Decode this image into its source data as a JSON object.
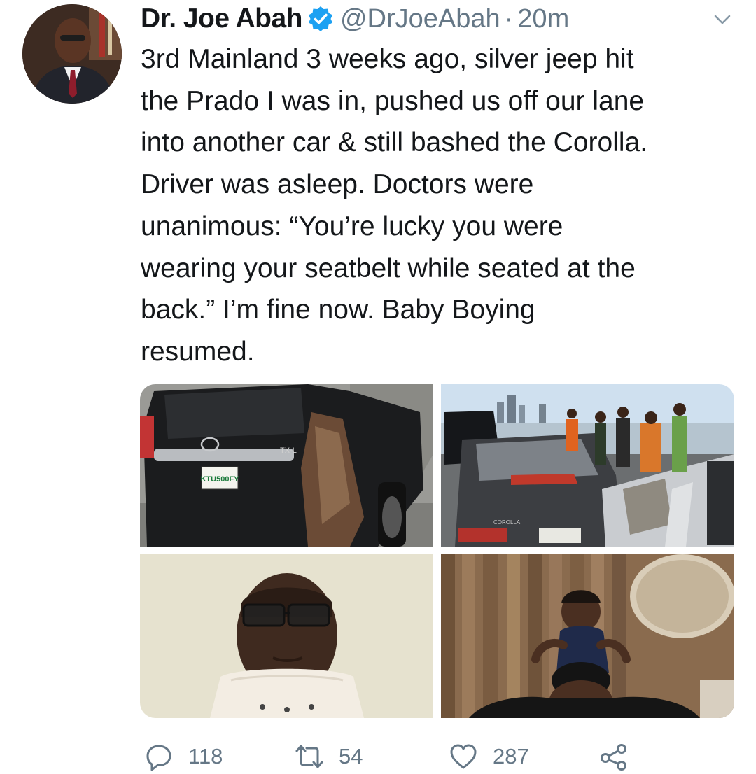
{
  "tweet": {
    "author_name": "Dr. Joe Abah",
    "handle": "@DrJoeAbah",
    "separator": "·",
    "time": "20m",
    "text": "3rd Mainland 3 weeks ago, silver jeep hit\nthe Prado I was in, pushed us off our lane\ninto another car & still bashed the Corolla.\nDriver was asleep. Doctors were\nunanimous: “You’re lucky you were\nwearing your seatbelt while seated at the\nback.” I’m fine now. Baby Boying\nresumed.",
    "media": {
      "photo1": {
        "badge": "TX-L",
        "plate": "KTU500FY"
      },
      "photo2": {
        "model_badge": "COROLLA"
      }
    }
  },
  "actions": {
    "replies": "118",
    "retweets": "54",
    "likes": "287"
  },
  "icons": {
    "verified": "verified-badge-icon",
    "caret": "chevron-down-icon",
    "reply": "reply-icon",
    "retweet": "retweet-icon",
    "like": "heart-icon",
    "share": "share-icon"
  },
  "colors": {
    "verified": "#1da1f2",
    "text": "#14171a",
    "muted": "#657786"
  }
}
